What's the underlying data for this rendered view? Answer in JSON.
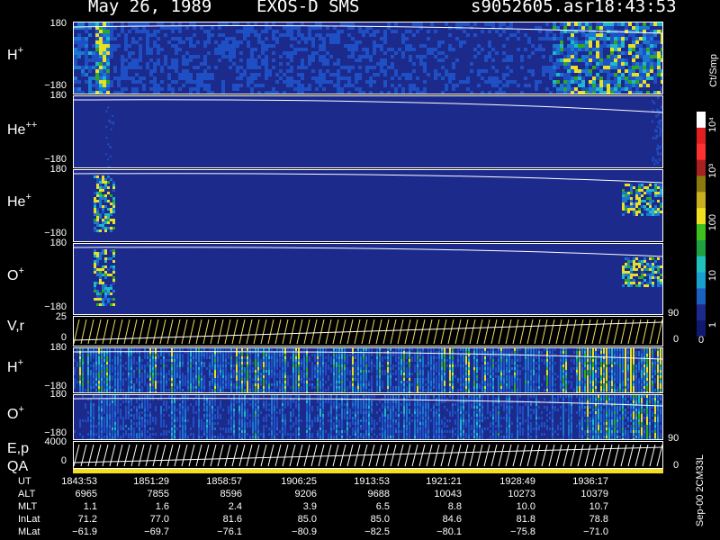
{
  "header": {
    "date": "May 26, 1989",
    "instrument": "EXOS-D SMS",
    "file": "s9052605.asr",
    "time": "18:43:53"
  },
  "panels": [
    {
      "label": "H",
      "sup": "+",
      "top_tick": "180",
      "bottom_tick": "−180"
    },
    {
      "label": "He",
      "sup": "++",
      "top_tick": "180",
      "bottom_tick": "−180"
    },
    {
      "label": "He",
      "sup": "+",
      "top_tick": "180",
      "bottom_tick": "−180"
    },
    {
      "label": "O",
      "sup": "+",
      "top_tick": "180",
      "bottom_tick": "−180"
    },
    {
      "label": "V,r",
      "sup": "",
      "top_tick": "25",
      "bottom_tick": "0",
      "right_top": "90",
      "right_bottom": "0"
    },
    {
      "label": "H",
      "sup": "+",
      "top_tick": "180",
      "bottom_tick": "−180"
    },
    {
      "label": "O",
      "sup": "+",
      "top_tick": "180",
      "bottom_tick": "−180"
    },
    {
      "label": "E,p",
      "sup": "",
      "top_tick": "4000",
      "bottom_tick": "0",
      "right_top": "90",
      "right_bottom": "0"
    }
  ],
  "qa_label": "QA",
  "colorbar": {
    "unit": "Ct/Smp",
    "labels": [
      "10⁴",
      "10³",
      "100",
      "10",
      "1",
      "0"
    ]
  },
  "footer_note": "Sep-00  2CM33L",
  "chart_data": {
    "type": "heatmap",
    "x": [
      "1843:53",
      "1851:29",
      "1858:57",
      "1906:25",
      "1913:53",
      "1921:21",
      "1928:49",
      "1936:17"
    ],
    "rows": [
      {
        "label": "UT",
        "values": [
          "1843:53",
          "1851:29",
          "1858:57",
          "1906:25",
          "1913:53",
          "1921:21",
          "1928:49",
          "1936:17"
        ]
      },
      {
        "label": "ALT",
        "values": [
          "6965",
          "7855",
          "8596",
          "9206",
          "9688",
          "10043",
          "10273",
          "10379"
        ]
      },
      {
        "label": "MLT",
        "values": [
          "1.1",
          "1.6",
          "2.4",
          "3.9",
          "6.5",
          "8.8",
          "10.0",
          "10.7"
        ]
      },
      {
        "label": "InLat",
        "values": [
          "71.2",
          "77.0",
          "81.6",
          "85.0",
          "85.0",
          "84.6",
          "81.8",
          "78.8"
        ]
      },
      {
        "label": "MLat",
        "values": [
          "−61.9",
          "−69.7",
          "−76.1",
          "−80.9",
          "−82.5",
          "−80.1",
          "−75.8",
          "−71.0"
        ]
      }
    ],
    "colors": {
      "background": "#1c2a8c",
      "low": "#1f4fc4",
      "mid": "#1fb8c8",
      "high": "#2fa820",
      "peak": "#e8e020"
    }
  }
}
